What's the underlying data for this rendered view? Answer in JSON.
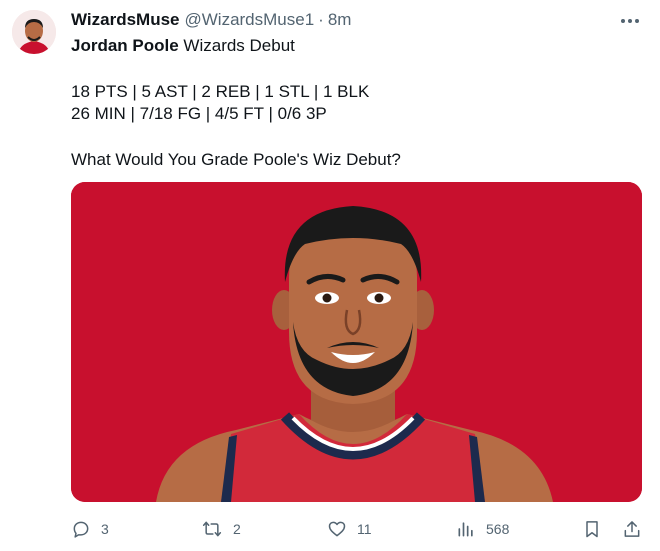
{
  "tweet": {
    "display_name": "WizardsMuse",
    "handle": "@WizardsMuse1",
    "separator": "·",
    "time": "8m",
    "title_bold": "Jordan Poole",
    "title_rest": " Wizards Debut",
    "stats_line1": "18 PTS | 5 AST | 2 REB | 1 STL | 1 BLK",
    "stats_line2": "26 MIN | 7/18 FG | 4/5 FT | 0/6 3P",
    "question": "What Would You Grade Poole's Wiz Debut?"
  },
  "actions": {
    "replies": "3",
    "retweets": "2",
    "likes": "11",
    "views": "568"
  },
  "colors": {
    "media_background": "#c8102e",
    "jersey_red": "#d2293a",
    "jersey_navy": "#1d2a4d",
    "skin": "#b66c45",
    "icon_gray": "#536471"
  },
  "icons": [
    "more-icon",
    "reply-icon",
    "retweet-icon",
    "like-icon",
    "views-icon",
    "bookmark-icon",
    "share-icon"
  ]
}
